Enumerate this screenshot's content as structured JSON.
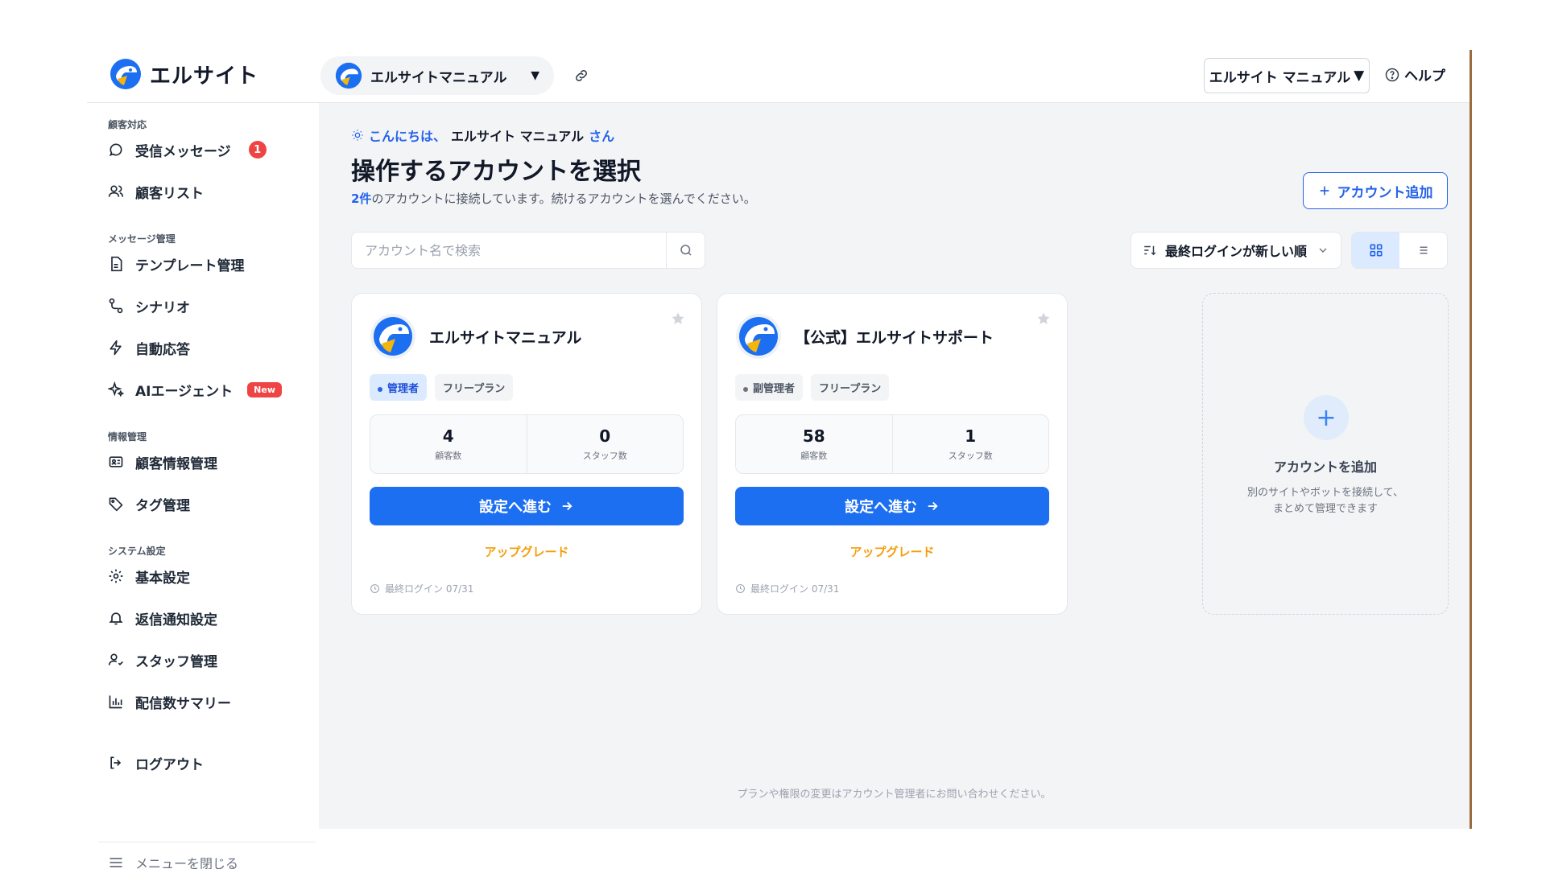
{
  "brand": {
    "name": "エルサイト"
  },
  "header": {
    "account_switcher": {
      "name": "エルサイトマニュアル",
      "caret": "▼"
    },
    "user_select": {
      "label": "エルサイト マニュアル",
      "caret": "▼"
    },
    "help_label": "ヘルプ"
  },
  "sidebar": {
    "sections": [
      {
        "label": "顧客対応"
      },
      {
        "label": "メッセージ管理"
      },
      {
        "label": "情報管理"
      },
      {
        "label": "システム設定"
      }
    ],
    "items": [
      {
        "label": "受信メッセージ",
        "icon": "chat-bubble-icon",
        "badge": "1"
      },
      {
        "label": "顧客リスト",
        "icon": "users-icon"
      },
      {
        "label": "テンプレート管理",
        "icon": "document-icon"
      },
      {
        "label": "シナリオ",
        "icon": "route-icon"
      },
      {
        "label": "自動応答",
        "icon": "bolt-icon"
      },
      {
        "label": "AIエージェント",
        "icon": "sparkle-icon",
        "badge": "New"
      },
      {
        "label": "顧客情報管理",
        "icon": "id-card-icon"
      },
      {
        "label": "タグ管理",
        "icon": "tag-icon"
      },
      {
        "label": "基本設定",
        "icon": "gear-icon"
      },
      {
        "label": "返信通知設定",
        "icon": "bell-icon"
      },
      {
        "label": "スタッフ管理",
        "icon": "staff-icon"
      },
      {
        "label": "配信数サマリー",
        "icon": "bar-chart-icon"
      },
      {
        "label": "ログアウト",
        "icon": "logout-icon"
      }
    ],
    "close_menu_label": "メニューを閉じる"
  },
  "main": {
    "greeting": {
      "prefix": "こんにちは、",
      "name": "エルサイト マニュアル",
      "suffix": "さん"
    },
    "title": "操作するアカウントを選択",
    "subtitle": {
      "count": "2件",
      "text": "のアカウントに接続しています。続けるアカウントを選んでください。"
    },
    "add_account_button": "アカウント追加",
    "search": {
      "placeholder": "アカウント名で検索",
      "value": ""
    },
    "sort": {
      "label": "最終ログインが新しい順"
    },
    "view_mode": "grid",
    "cards": [
      {
        "name": "エルサイトマニュアル",
        "role": "管理者",
        "plan": "フリープラン",
        "customers": "4",
        "customers_label": "顧客数",
        "staff": "0",
        "staff_label": "スタッフ数",
        "action": "設定へ進む",
        "upgrade": "アップグレード",
        "last_login": "最終ログイン 07/31"
      },
      {
        "name": "【公式】エルサイトサポート",
        "role": "副管理者",
        "plan": "フリープラン",
        "customers": "58",
        "customers_label": "顧客数",
        "staff": "1",
        "staff_label": "スタッフ数",
        "action": "設定へ進む",
        "upgrade": "アップグレード",
        "last_login": "最終ログイン 07/31"
      }
    ],
    "add_card": {
      "title": "アカウントを追加",
      "desc_line1": "別のサイトやボットを接続して、",
      "desc_line2": "まとめて管理できます"
    },
    "footer_note": "プランや権限の変更はアカウント管理者にお問い合わせください。"
  },
  "colors": {
    "accent": "#1d6ff2",
    "upgrade": "#f59e0b",
    "badge_red": "#ef4444"
  }
}
